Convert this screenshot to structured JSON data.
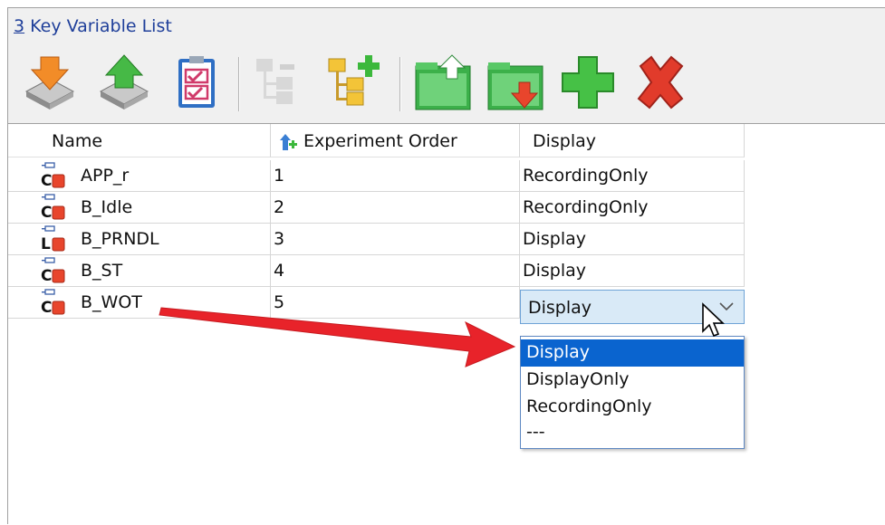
{
  "window": {
    "title_accel": "3",
    "title_rest": " Key Variable List"
  },
  "toolbar": {
    "icons": [
      "import-icon",
      "export-icon",
      "checklist-icon",
      "tree-collapse-icon",
      "tree-add-icon",
      "folder-up-icon",
      "folder-down-icon",
      "add-icon",
      "delete-icon"
    ]
  },
  "table": {
    "columns": [
      "Name",
      "Experiment Order",
      "Display"
    ],
    "rows": [
      {
        "type_letter": "C",
        "name": "APP_r",
        "order": "1",
        "display": "RecordingOnly"
      },
      {
        "type_letter": "C",
        "name": "B_Idle",
        "order": "2",
        "display": "RecordingOnly"
      },
      {
        "type_letter": "L",
        "name": "B_PRNDL",
        "order": "3",
        "display": "Display"
      },
      {
        "type_letter": "C",
        "name": "B_ST",
        "order": "4",
        "display": "Display"
      },
      {
        "type_letter": "C",
        "name": "B_WOT",
        "order": "5",
        "display": "Display"
      }
    ]
  },
  "dropdown": {
    "selected": "Display",
    "options": [
      "Display",
      "DisplayOnly",
      "RecordingOnly",
      "---"
    ]
  },
  "colors": {
    "title": "#1f3f9a",
    "selection": "#0a64cf",
    "combo_bg": "#d9eaf7",
    "arrow": "#e8232a",
    "icon_green": "#3cb83c",
    "icon_red": "#e13b2b",
    "icon_red_square": "#e8452c"
  }
}
